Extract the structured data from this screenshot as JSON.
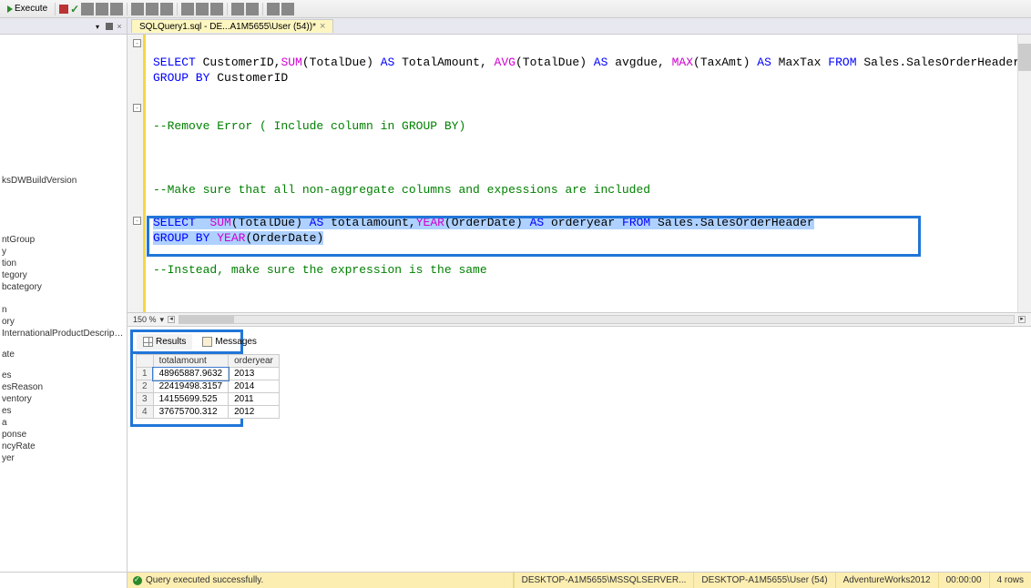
{
  "toolbar": {
    "execute_label": "Execute"
  },
  "explorer": {
    "items": [
      "ksDWBuildVersion",
      "",
      "",
      "ntGroup",
      "y",
      "tion",
      "tegory",
      "bcategory",
      "",
      "n",
      "ory",
      "InternationalProductDescription",
      "ate",
      "",
      "es",
      "esReason",
      "ventory",
      "es",
      "a",
      "ponse",
      "ncyRate",
      "yer"
    ]
  },
  "tab": {
    "label": "SQLQuery1.sql - DE...A1M5655\\User (54))*"
  },
  "code": {
    "line1a": "SELECT",
    "line1b": " CustomerID",
    "line1c": ",",
    "line1d": "SUM",
    "line1e": "(",
    "line1f": "TotalDue",
    "line1g": ") ",
    "line1h": "AS",
    "line1i": " TotalAmount",
    "line1j": ", ",
    "line1k": "AVG",
    "line1l": "(",
    "line1m": "TotalDue",
    "line1n": ") ",
    "line1o": "AS",
    "line1p": " avgdue",
    "line1q": ", ",
    "line1r": "MAX",
    "line1s": "(",
    "line1t": "TaxAmt",
    "line1u": ") ",
    "line1v": "AS",
    "line1w": " MaxTax ",
    "line1x": "FROM",
    "line1y": " Sales",
    "line1z": ".",
    "line1aa": "SalesOrderHeader",
    "line2a": "GROUP BY",
    "line2b": " CustomerID",
    "line4": "--Remove Error ( Include column in GROUP BY)",
    "line6": "--Make sure that all non-aggregate columns and expessions are included",
    "line7a": "SELECT",
    "line7sp": "  ",
    "line7b": "SUM",
    "line7c": "(",
    "line7d": "TotalDue",
    "line7e": ") ",
    "line7f": "AS",
    "line7g": " totalamount",
    "line7h": ",",
    "line7i": "YEAR",
    "line7j": "(",
    "line7k": "OrderDate",
    "line7l": ") ",
    "line7m": "AS",
    "line7n": " orderyear ",
    "line7o": "FROM",
    "line7p": " Sales",
    "line7q": ".",
    "line7r": "SalesOrderHeader",
    "line8a": "GROUP BY",
    "line8b": " ",
    "line8c": "YEAR",
    "line8d": "(",
    "line8e": "OrderDate",
    "line8f": ")",
    "line9": "--Instead, make sure the expression is the same"
  },
  "zoom": "150 %",
  "results": {
    "tab_results": "Results",
    "tab_messages": "Messages",
    "columns": [
      "",
      "totalamount",
      "orderyear"
    ],
    "rows": [
      [
        "1",
        "48965887.9632",
        "2013"
      ],
      [
        "2",
        "22419498.3157",
        "2014"
      ],
      [
        "3",
        "14155699.525",
        "2011"
      ],
      [
        "4",
        "37675700.312",
        "2012"
      ]
    ]
  },
  "status": {
    "message": "Query executed successfully.",
    "server": "DESKTOP-A1M5655\\MSSQLSERVER...",
    "user": "DESKTOP-A1M5655\\User (54)",
    "db": "AdventureWorks2012",
    "time": "00:00:00",
    "rows": "4 rows"
  }
}
